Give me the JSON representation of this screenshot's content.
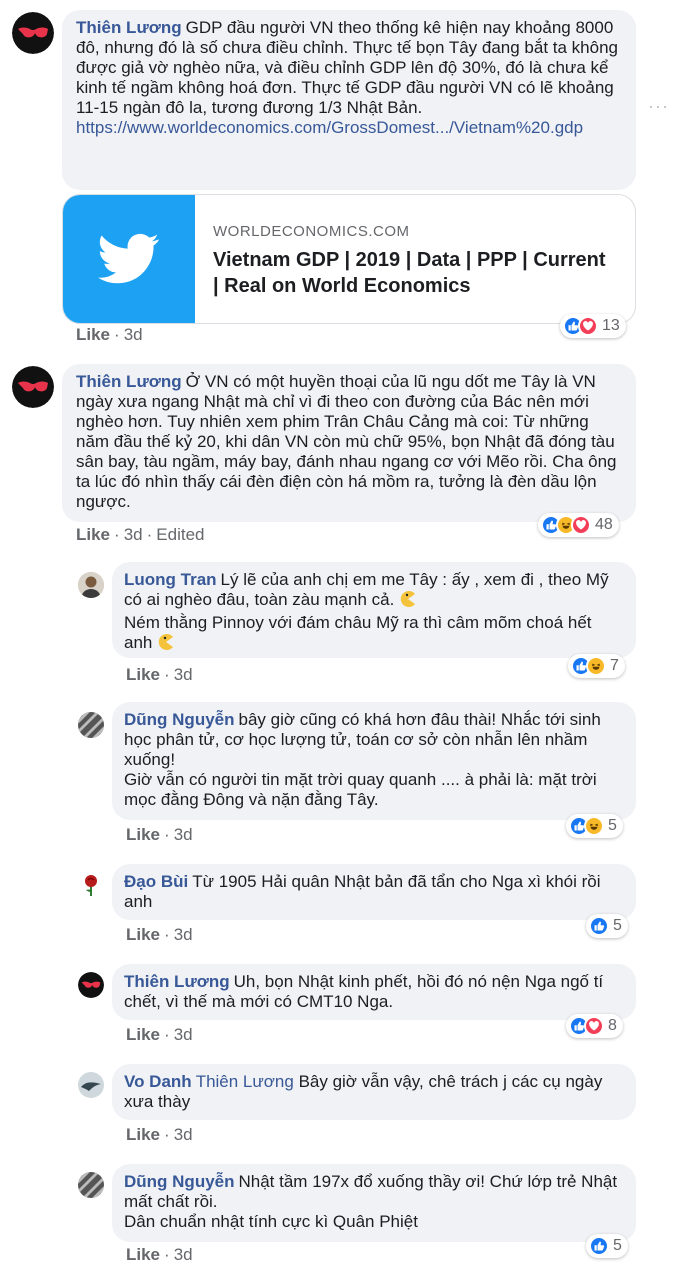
{
  "comments": [
    {
      "name": "Thiên Lương",
      "text": "GDP đầu người VN theo thống kê hiện nay khoảng 8000 đô, nhưng đó là số chưa điều chỉnh. Thực tế bọn Tây đang bắt ta không được giả vờ nghèo nữa, và điều chỉnh GDP lên độ 30%, đó là chưa kể kinh tế ngầm không hoá đơn. Thực tế GDP đầu người VN có lẽ khoảng 11-15 ngàn đô la, tương đương 1/3 Nhật Bản.",
      "link": "https://www.worldeconomics.com/GrossDomest.../Vietnam%20.gdp",
      "card": {
        "domain": "WORLDECONOMICS.COM",
        "title": "Vietnam GDP | 2019 | Data | PPP | Current | Real on World Economics"
      },
      "like": "Like",
      "time": "3d",
      "reactions": "13"
    },
    {
      "name": "Thiên Lương",
      "text": "Ở VN có một huyền thoại của lũ ngu dốt me Tây là VN ngày xưa ngang Nhật mà chỉ vì đi theo con đường của Bác nên mới nghèo hơn. Tuy nhiên xem phim Trân Châu Cảng mà coi: Từ những năm đầu thế kỷ 20, khi dân VN còn mù chữ 95%, bọn Nhật đã đóng tàu sân bay, tàu ngầm, máy bay, đánh nhau ngang cơ với Mẽo rồi. Cha ông ta lúc đó nhìn thấy cái đèn điện còn há mồm ra, tưởng là đèn dầu lộn ngược.",
      "like": "Like",
      "time": "3d",
      "edited": "Edited",
      "reactions": "48"
    },
    {
      "name": "Luong Tran",
      "text_line1": "Lý lẽ của anh chị em me Tây : ấy , xem đi , theo Mỹ có ai nghèo đâu, toàn zàu mạnh cả.",
      "text_line2": "Ném thằng Pinnoy với đám châu Mỹ ra thì câm mõm choá hết anh",
      "like": "Like",
      "time": "3d",
      "reactions": "7"
    },
    {
      "name": "Dũng Nguyễn",
      "text_line1": "bây giờ cũng có khá hơn đâu thài! Nhắc tới sinh học phân tử, cơ học lượng tử, toán cơ sở còn nhẫn lên nhầm xuống!",
      "text_line2": "Giờ vẫn có người tin mặt trời quay quanh .... à phải là: mặt trời mọc đằng Đông và nặn đằng Tây.",
      "like": "Like",
      "time": "3d",
      "reactions": "5"
    },
    {
      "name": "Đạo Bùi",
      "text": "Từ 1905 Hải quân Nhật bản đã tẩn cho Nga xì khói rồi anh",
      "like": "Like",
      "time": "3d",
      "reactions": "5"
    },
    {
      "name": "Thiên Lương",
      "text": "Uh, bọn Nhật kinh phết, hồi đó nó nện Nga ngố tí chết, vì thế mà mới có CMT10 Nga.",
      "like": "Like",
      "time": "3d",
      "reactions": "8"
    },
    {
      "name": "Vo Danh",
      "mention": "Thiên Lương",
      "text": "Bây giờ vẫn vậy, chê trách j các cụ ngày xưa thày",
      "like": "Like",
      "time": "3d"
    },
    {
      "name": "Dũng Nguyễn",
      "text_line1": "Nhật tầm 197x đổ xuống thầy ơi! Chứ lớp trẻ Nhật mất chất rồi.",
      "text_line2": "Dân chuẩn nhật tính cực kì Quân Phiệt",
      "like": "Like",
      "time": "3d",
      "reactions": "5"
    }
  ],
  "more_options": "···",
  "colors": {
    "link": "#385898",
    "bubble": "#f0f2f5",
    "like": "#1877f2",
    "love": "#f33e58",
    "haha": "#f7b928",
    "twitter": "#1da1f2"
  }
}
